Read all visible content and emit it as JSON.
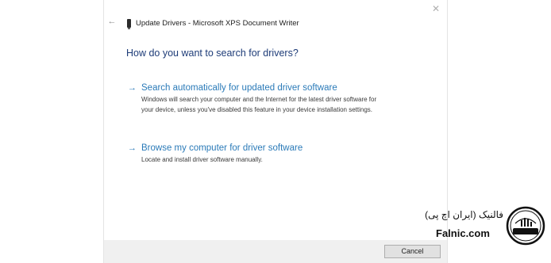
{
  "window": {
    "back_glyph": "←",
    "title": "Update Drivers - Microsoft XPS Document Writer",
    "close_glyph": "✕"
  },
  "main": {
    "heading": "How do you want to search for drivers?",
    "options": [
      {
        "arrow": "→",
        "title": "Search automatically for updated driver software",
        "description_lines": [
          "Windows will search your computer and the Internet for the latest driver software for",
          "your device, unless you've disabled this feature in your device installation settings."
        ]
      },
      {
        "arrow": "→",
        "title": "Browse my computer for driver software",
        "description_lines": [
          "Locate and install driver software manually."
        ]
      }
    ]
  },
  "footer": {
    "cancel_label": "Cancel"
  },
  "watermark": {
    "persian_text": "فالنیک (ایران اچ پی)",
    "latin_text": "Falnic.com",
    "logo_text": "iranhp"
  },
  "colors": {
    "link_blue": "#2a7ab8",
    "heading_blue": "#1e3c78",
    "footer_gray": "#f0f0f0"
  },
  "icons": [
    "back-arrow-icon",
    "driver-device-icon",
    "close-icon",
    "option-arrow-icon",
    "iranhp-logo-icon"
  ]
}
